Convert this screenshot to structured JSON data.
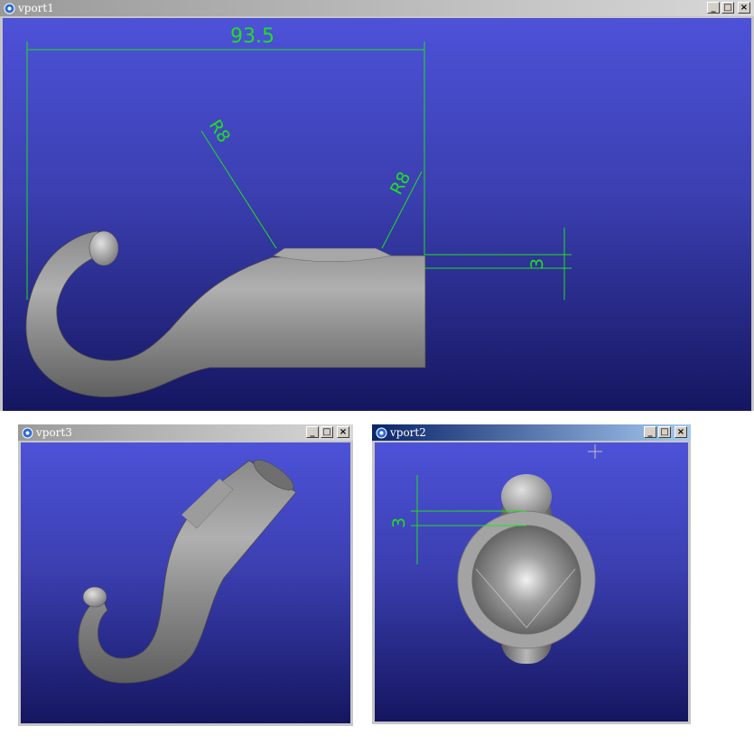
{
  "windows": {
    "vport1": {
      "title": "vport1"
    },
    "vport3": {
      "title": "vport3"
    },
    "vport2": {
      "title": "vport2"
    }
  },
  "buttons": {
    "minimize": "_",
    "maximize": "□",
    "close": "×"
  },
  "dimensions": {
    "length": "93.5",
    "radius_left": "R8",
    "radius_right": "R8",
    "offset_side": "3",
    "offset_end": "3"
  },
  "colors": {
    "dimension_line": "#1fe01f",
    "viewport_top": "#4d52d8",
    "viewport_bottom": "#151660",
    "active_title": "#0a246a"
  },
  "icons": {
    "window_icon": "gear-icon"
  }
}
